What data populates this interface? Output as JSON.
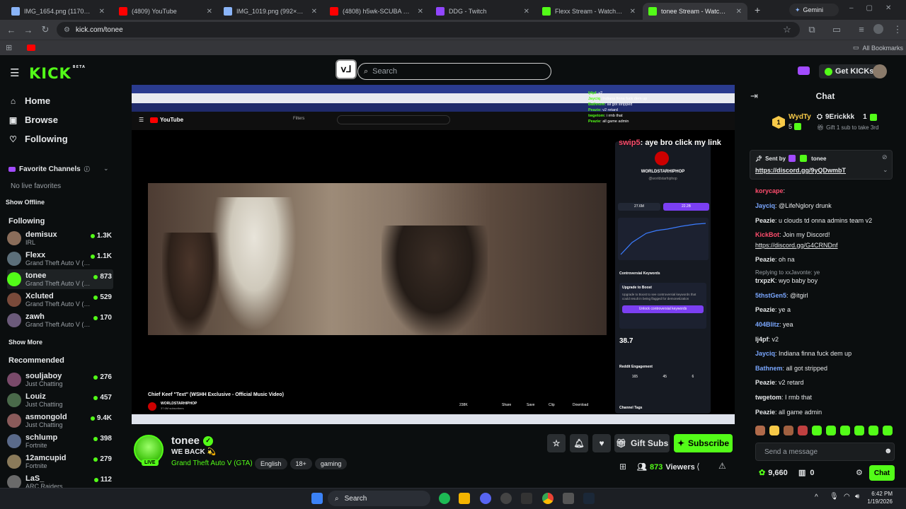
{
  "browser": {
    "tabs": [
      {
        "title": "IMG_1654.png (1170×581)",
        "active": false,
        "color": "#8ab4f8"
      },
      {
        "title": "(4809) YouTube",
        "active": false,
        "color": "#ff0000"
      },
      {
        "title": "IMG_1019.png (992×597)",
        "active": false,
        "color": "#8ab4f8"
      },
      {
        "title": "(4808) h5wk-SCUBA JUKE(IT",
        "active": false,
        "color": "#ff0000"
      },
      {
        "title": "DDG - Twitch",
        "active": false,
        "color": "#9146ff"
      },
      {
        "title": "Flexx Stream - Watch Live on",
        "active": false,
        "color": "#53fc18"
      },
      {
        "title": "tonee Stream - Watch Live on",
        "active": true,
        "color": "#53fc18"
      }
    ],
    "gemini_label": "Gemini",
    "url": "kick.com/tonee",
    "all_bookmarks": "All Bookmarks"
  },
  "header": {
    "logo": "KICK",
    "logo_sup": "BETA",
    "search_placeholder": "Search",
    "get_kicks": "Get KICKs"
  },
  "sidebar": {
    "nav": [
      {
        "label": "Home",
        "icon": "home-icon"
      },
      {
        "label": "Browse",
        "icon": "browse-icon"
      },
      {
        "label": "Following",
        "icon": "heart-icon"
      }
    ],
    "favorite_title": "Favorite Channels",
    "no_favorites": "No live favorites",
    "show_offline": "Show Offline",
    "following_title": "Following",
    "following": [
      {
        "name": "demisux",
        "category": "IRL",
        "viewers": "1.3K",
        "color": "#8a6d5a"
      },
      {
        "name": "Flexx",
        "category": "Grand Theft Auto V (G...",
        "viewers": "1.1K",
        "color": "#5c6f7a"
      },
      {
        "name": "tonee",
        "category": "Grand Theft Auto V (G...",
        "viewers": "873",
        "color": "#53fc18"
      },
      {
        "name": "Xcluted",
        "category": "Grand Theft Auto V (G...",
        "viewers": "529",
        "color": "#7a4a3a"
      },
      {
        "name": "zawh",
        "category": "Grand Theft Auto V (G...",
        "viewers": "170",
        "color": "#6b5a7a"
      }
    ],
    "show_more": "Show More",
    "recommended_title": "Recommended",
    "recommended": [
      {
        "name": "souljaboy",
        "category": "Just Chatting",
        "viewers": "276",
        "color": "#7a4a6a"
      },
      {
        "name": "Louiz",
        "category": "Just Chatting",
        "viewers": "457",
        "color": "#4a6a4a"
      },
      {
        "name": "asmongold",
        "category": "Just Chatting",
        "viewers": "9.4K",
        "color": "#8a5a5a"
      },
      {
        "name": "schlump",
        "category": "Fortnite",
        "viewers": "398",
        "color": "#5a6a8a"
      },
      {
        "name": "12amcupid",
        "category": "Fortnite",
        "viewers": "279",
        "color": "#8a7a5a"
      },
      {
        "name": "LaS_",
        "category": "ARC Raiders",
        "viewers": "112",
        "color": "#6a6a6a"
      }
    ]
  },
  "video": {
    "yt_logo": "YouTube",
    "filters": "Filters",
    "title": "Chief Keef \"Text\" (WSHH Exclusive - Official Music Video)",
    "channel": "WORLDSTARHIPHOP",
    "subs": "37.6M subscribers",
    "likes": "238K",
    "share": "Share",
    "save": "Save",
    "clip": "Clip",
    "download": "Download",
    "panel_channel": "WORLDSTARHIPHOP",
    "panel_handle": "@worldstarhiphop",
    "panel_stat_a": "27.6M",
    "panel_stat_b": "22.2B",
    "panel_section": "Controversial Keywords",
    "panel_upgrade": "Upgrade to Boost",
    "panel_desc": "Upgrade to Boost to see controversial keywords that could result in being flagged for demonetization",
    "panel_unlock": "Unlock controversial keywords",
    "panel_score": "38.7",
    "panel_reddit": "Reddit Engagement",
    "panel_reddit_vals": [
      "165",
      "45",
      "6"
    ],
    "panel_channel_tags": "Channel Tags",
    "overlay_chat": [
      {
        "user": "lj4pf",
        "text": "v2"
      },
      {
        "user": "Jayciq",
        "text": "Indiana finna fuck dem up"
      },
      {
        "user": "Bathnem",
        "text": "all got stripped"
      },
      {
        "user": "Peazie",
        "text": "v2 retard"
      },
      {
        "user": "twgetom",
        "text": "i rmb that"
      },
      {
        "user": "Peazie",
        "text": "all game admin"
      }
    ],
    "overlay_msg_user": "swip5",
    "overlay_msg_text": "aye bro click my link"
  },
  "stream": {
    "name": "tonee",
    "title": "WE BACK 💫",
    "category": "Grand Theft Auto V (GTA)",
    "tags": [
      "English",
      "18+",
      "gaming"
    ],
    "live": "LIVE",
    "gift_subs": "Gift Subs",
    "subscribe": "Subscribe",
    "viewers": "873",
    "viewers_label": "Viewers"
  },
  "chat": {
    "title": "Chat",
    "gifter1_name": "WydTy",
    "gifter1_count": "5",
    "gifter2_name": "9Erickkk",
    "gifter2_count": "1",
    "gift_promo": "Gift 1 sub to take 3rd",
    "pinned_by": "Sent by",
    "pinned_user": "tonee",
    "pinned_link": "https://discord.gg/9yQDwmbT",
    "messages": [
      {
        "user": "korycape",
        "text": "",
        "color": "#ff4d6d"
      },
      {
        "user": "Jayciq",
        "text": "@LifeNglory drunk",
        "color": "#7aa7ff"
      },
      {
        "user": "Peazie",
        "text": "u clouds td onna admins team v2",
        "color": "#e6e8ea"
      },
      {
        "user": "KickBot",
        "text": "Join my Discord!",
        "color": "#ff4d6d"
      },
      {
        "user": "",
        "text": "https://discord.gg/G4CRNDnf",
        "color": "#e6e8ea"
      },
      {
        "user": "Peazie",
        "text": "oh na",
        "color": "#e6e8ea"
      },
      {
        "user": "",
        "text": "Replying to xxJavonte: ye",
        "color": "#9aa0a6"
      },
      {
        "user": "trxpzK",
        "text": "wyo baby boy",
        "color": "#e6e8ea"
      },
      {
        "user": "5thstGen5",
        "text": "@itgirl",
        "color": "#7aa7ff"
      },
      {
        "user": "Peazie",
        "text": "ye a",
        "color": "#e6e8ea"
      },
      {
        "user": "404Blitz",
        "text": "yea",
        "color": "#7aa7ff"
      },
      {
        "user": "lj4pf",
        "text": "v2",
        "color": "#e6e8ea"
      },
      {
        "user": "Jayciq",
        "text": "Indiana finna fuck dem up",
        "color": "#7aa7ff"
      },
      {
        "user": "Bathnem",
        "text": "all got stripped",
        "color": "#7aa7ff"
      },
      {
        "user": "Peazie",
        "text": "v2 retard",
        "color": "#e6e8ea"
      },
      {
        "user": "twgetom",
        "text": "I rmb that",
        "color": "#e6e8ea"
      },
      {
        "user": "Peazie",
        "text": "all game admin",
        "color": "#e6e8ea"
      }
    ],
    "input_placeholder": "Send a message",
    "points": "9,660",
    "gifts": "0",
    "chat_button": "Chat"
  },
  "taskbar": {
    "search": "Search",
    "time": "6:42 PM",
    "date": "1/19/2026"
  }
}
